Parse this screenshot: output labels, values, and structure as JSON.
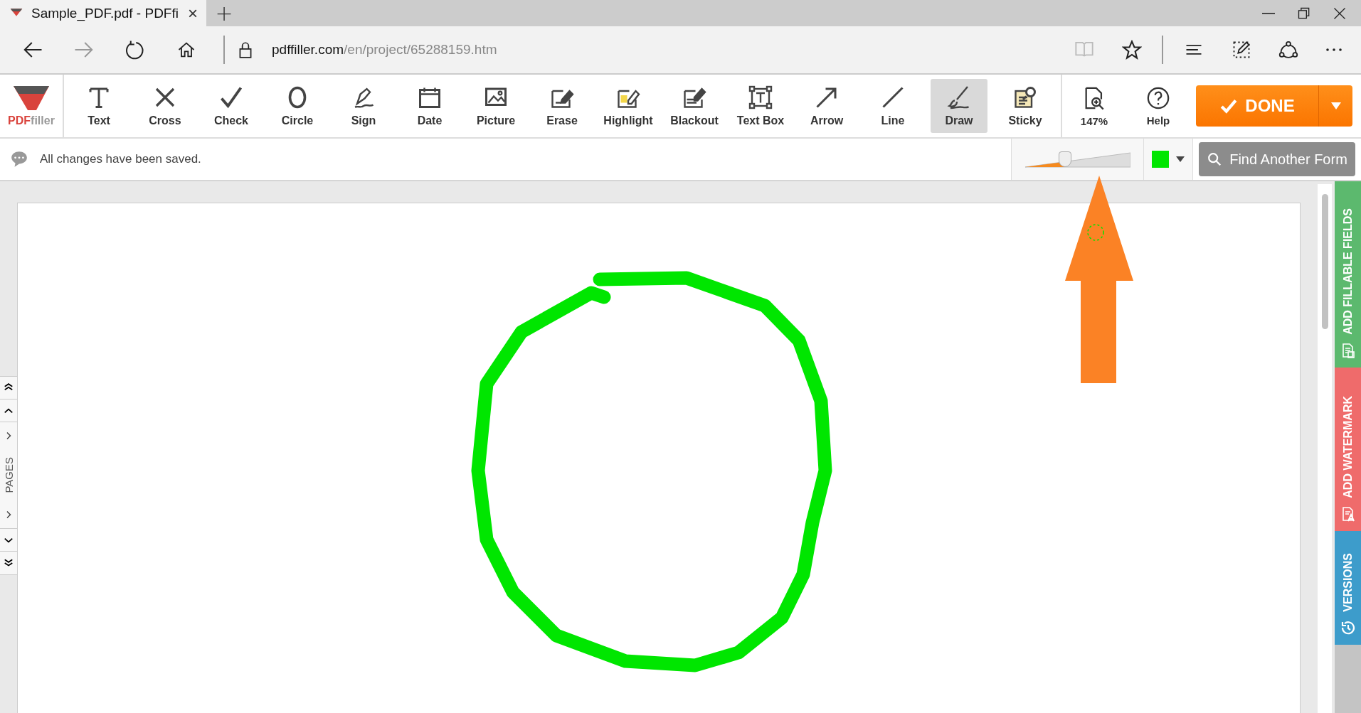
{
  "browser": {
    "tab": {
      "title": "Sample_PDF.pdf - PDFfi",
      "close": "×"
    },
    "new_tab": "+",
    "url_domain": "pdffiller.com",
    "url_path": "/en/project/65288159.htm",
    "reading_view_disabled": true
  },
  "toolbar": {
    "logo": {
      "pdf": "PDF",
      "filler": "filler"
    },
    "tools": [
      {
        "label": "Text",
        "selected": false
      },
      {
        "label": "Cross",
        "selected": false
      },
      {
        "label": "Check",
        "selected": false
      },
      {
        "label": "Circle",
        "selected": false
      },
      {
        "label": "Sign",
        "selected": false
      },
      {
        "label": "Date",
        "selected": false
      },
      {
        "label": "Picture",
        "selected": false
      },
      {
        "label": "Erase",
        "selected": false
      },
      {
        "label": "Highlight",
        "selected": false
      },
      {
        "label": "Blackout",
        "selected": false
      },
      {
        "label": "Text Box",
        "selected": false
      },
      {
        "label": "Arrow",
        "selected": false
      },
      {
        "label": "Line",
        "selected": false
      },
      {
        "label": "Draw",
        "selected": true
      },
      {
        "label": "Sticky",
        "selected": false
      }
    ],
    "zoom": "147%",
    "help": "Help",
    "done": "DONE"
  },
  "status_bar": {
    "message": "All changes have been saved.",
    "thickness_slider": {
      "level": 0.38
    },
    "color_picker": {
      "color": "#00e600"
    },
    "find_button": "Find Another Form"
  },
  "pages_panel": {
    "label": "PAGES"
  },
  "side_tabs": [
    {
      "label": "ADD FILLABLE FIELDS",
      "color": "#5cb96e"
    },
    {
      "label": "ADD WATERMARK",
      "color": "#ef6b6b"
    },
    {
      "label": "VERSIONS",
      "color": "#3d9ccb"
    }
  ]
}
